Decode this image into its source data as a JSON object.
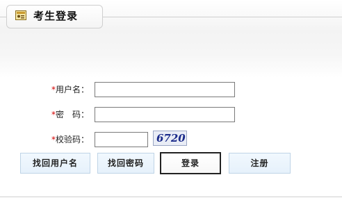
{
  "panel": {
    "title": "考生登录",
    "icon": "id-card-icon"
  },
  "form": {
    "username_label": "用户名：",
    "password_label": "密　码：",
    "captcha_label": "校验码：",
    "required_mark": "*",
    "username_value": "",
    "password_value": "",
    "captcha_value": "",
    "captcha_image_text": "6720"
  },
  "buttons": {
    "find_username": "找回用户名",
    "find_password": "找回密码",
    "login": "登录",
    "register": "注册"
  }
}
